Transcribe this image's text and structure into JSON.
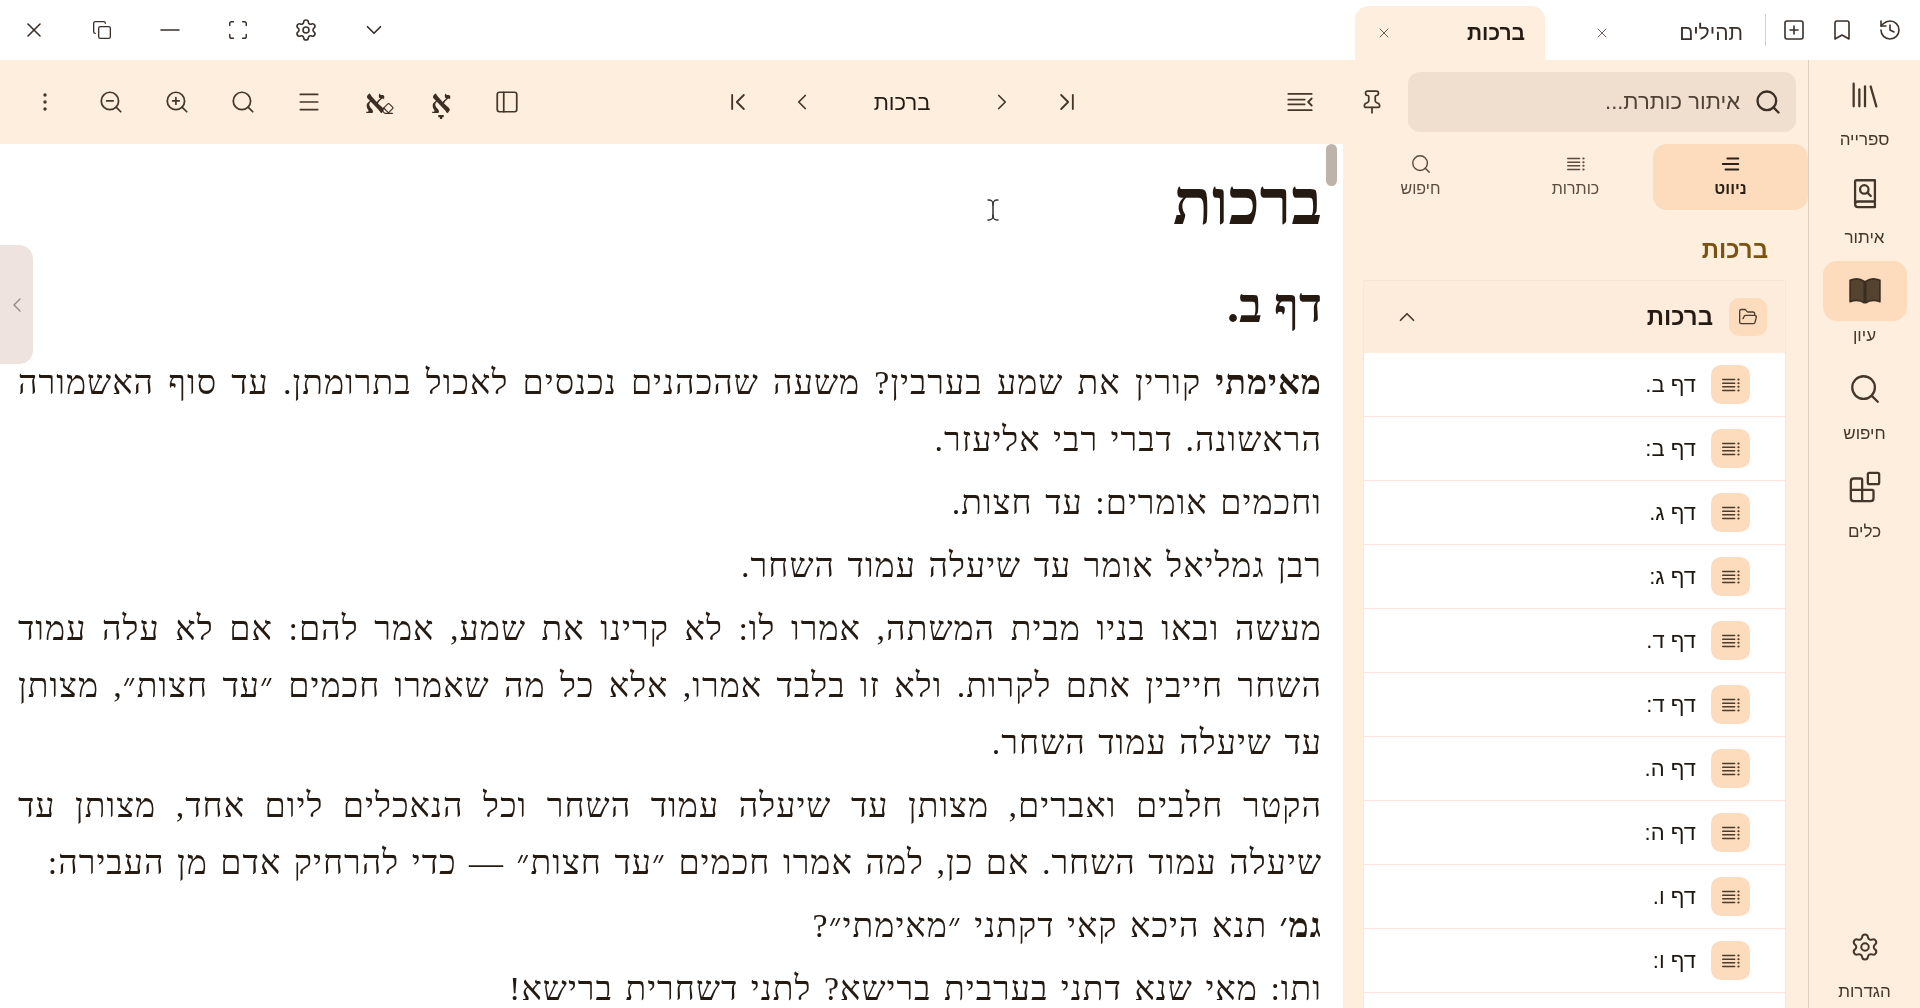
{
  "title_bar": {
    "tabs": [
      {
        "label": "תהילים",
        "selected": false
      },
      {
        "label": "ברכות",
        "selected": true
      }
    ]
  },
  "toolbar": {
    "title": "ברכות",
    "glyph_buttons": [
      {
        "kind": "plain",
        "glyph": "אָ"
      },
      {
        "kind": "erase",
        "glyph": "א"
      }
    ]
  },
  "nav_panel": {
    "search": {
      "placeholder": "איתור כותרת..."
    },
    "tabs": [
      {
        "label": "ניווט",
        "selected": true
      },
      {
        "label": "כותרות",
        "selected": false
      },
      {
        "label": "חיפוש",
        "selected": false
      }
    ],
    "heading": "ברכות",
    "tree": {
      "label": "ברכות",
      "expanded": true,
      "children": [
        {
          "label": "דף ב."
        },
        {
          "label": "דף ב:"
        },
        {
          "label": "דף ג."
        },
        {
          "label": "דף ג:"
        },
        {
          "label": "דף ד."
        },
        {
          "label": "דף ד:"
        },
        {
          "label": "דף ה."
        },
        {
          "label": "דף ה:"
        },
        {
          "label": "דף ו."
        },
        {
          "label": "דף ו:"
        }
      ]
    }
  },
  "rail": {
    "items": [
      {
        "label": "ספרייה",
        "selected": false
      },
      {
        "label": "איתור",
        "selected": false
      },
      {
        "label": "עיון",
        "selected": true
      },
      {
        "label": "חיפוש",
        "selected": false
      },
      {
        "label": "כלים",
        "selected": false
      }
    ],
    "settings": "הגדרות"
  },
  "document": {
    "title": "ברכות",
    "heading": "דף ב.",
    "paragraphs": [
      "**מאימתי** קורין את שמע בערבין? משעה שהכהנים נכנסים לאכול בתרומתן. עד סוף האשמורה הראשונה. דברי רבי אליעזר.",
      "וחכמים אומרים: עד חצות.",
      "רבן גמליאל אומר עד שיעלה עמוד השחר.",
      "מעשה ובאו בניו מבית המשתה, אמרו לו: לא קרינו את שמע, אמר להם: אם לא עלה עמוד השחר חייבין אתם לקרות. ולא זו בלבד אמרו, אלא כל מה שאמרו חכמים ״עד חצות״, מצותן עד שיעלה עמוד השחר.",
      "הקטר חלבים ואברים, מצותן עד שיעלה עמוד השחר וכל הנאכלים ליום אחד, מצותן עד שיעלה עמוד השחר. אם כן, למה אמרו חכמים ״עד חצות״ — כדי להרחיק אדם מן העבירה:",
      "**גמ׳** תנא היכא קאי דקתני ״מאימתי״?",
      "ותו: מאי שנא דתני בערבית ברישא? לתני דשחרית ברישא!"
    ]
  }
}
